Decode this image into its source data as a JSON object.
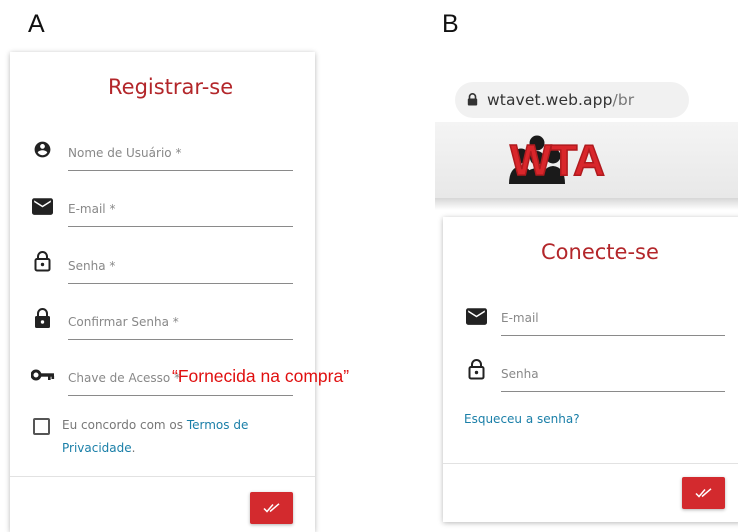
{
  "panels": {
    "a_letter": "A",
    "b_letter": "B"
  },
  "register": {
    "title": "Registrar-se",
    "fields": {
      "username": "Nome de Usuário *",
      "email": "E-mail *",
      "password": "Senha *",
      "confirm": "Confirmar Senha *",
      "access_key": "Chave de Acesso *"
    },
    "annotation": "“Fornecida na compra”",
    "agree_prefix": "Eu concordo com os ",
    "agree_link_1": "Termos de",
    "agree_link_2": "Privacidade",
    "agree_suffix": "."
  },
  "browser": {
    "url_main": "wtavet.web.app",
    "url_suffix": "/br"
  },
  "logo": {
    "text": "WTA"
  },
  "login": {
    "title": "Conecte-se",
    "fields": {
      "email": "E-mail",
      "password": "Senha"
    },
    "forgot": "Esqueceu a senha?"
  },
  "colors": {
    "brand_red": "#d32a2e",
    "title_red": "#b3262a",
    "link_blue": "#1a7fa8",
    "annotation_red": "#e01010"
  },
  "icons": [
    "account-circle-icon",
    "mail-icon",
    "lock-open-icon",
    "lock-icon",
    "key-icon",
    "double-check-icon",
    "url-lock-icon"
  ]
}
